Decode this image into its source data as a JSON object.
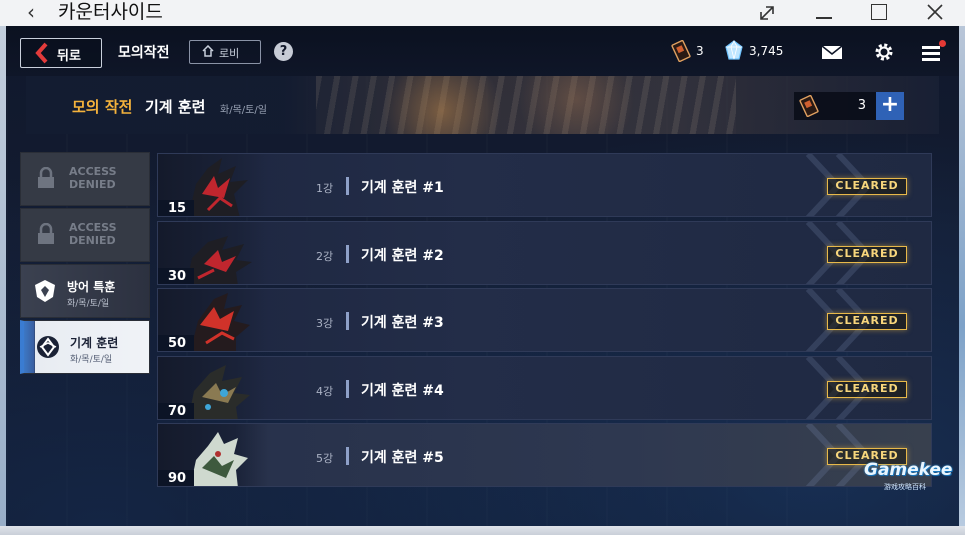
{
  "window": {
    "back_glyph": "‹",
    "title": "카운터사이드",
    "controls": [
      "expand-icon",
      "minimize-icon",
      "maximize-icon",
      "close-icon"
    ]
  },
  "topbar": {
    "back_label": "뒤로",
    "page_name": "모의작전",
    "lobby_label": "로비",
    "help_label": "?",
    "ticket_count": "3",
    "gem_count": "3,745",
    "icons": [
      "ticket-icon",
      "gem-icon",
      "mail-icon",
      "gear-icon",
      "menu-icon"
    ]
  },
  "banner": {
    "title_accent": "모의 작전",
    "title_main": "기계 훈련",
    "days": "화/목/토/일",
    "ticket_count": "3",
    "plus_label": "+"
  },
  "side": {
    "items": [
      {
        "state": "locked",
        "label_line1": "ACCESS",
        "label_line2": "DENIED"
      },
      {
        "state": "locked",
        "label_line1": "ACCESS",
        "label_line2": "DENIED"
      },
      {
        "state": "available",
        "name": "방어 특훈",
        "days": "화/목/토/일"
      },
      {
        "state": "selected",
        "name": "기계 훈련",
        "days": "화/목/토/일"
      }
    ]
  },
  "stages": [
    {
      "level": "15",
      "num": "1강",
      "name": "기계 훈련 #1",
      "status": "CLEARED",
      "accent": "#c0262e"
    },
    {
      "level": "30",
      "num": "2강",
      "name": "기계 훈련 #2",
      "status": "CLEARED",
      "accent": "#c0262e"
    },
    {
      "level": "50",
      "num": "3강",
      "name": "기계 훈련 #3",
      "status": "CLEARED",
      "accent": "#d0322a"
    },
    {
      "level": "70",
      "num": "4강",
      "name": "기계 훈련 #4",
      "status": "CLEARED",
      "accent": "#3ea6d8"
    },
    {
      "level": "90",
      "num": "5강",
      "name": "기계 훈련 #5",
      "status": "CLEARED",
      "accent": "#cfd9cf"
    }
  ],
  "watermark": {
    "title": "Gamekee",
    "subtitle": "游戏攻略百科"
  },
  "colors": {
    "accent_gold": "#f4b23c",
    "cleared": "#e8b94a",
    "button_blue": "#2f62b6",
    "badge_red": "#e53935"
  }
}
